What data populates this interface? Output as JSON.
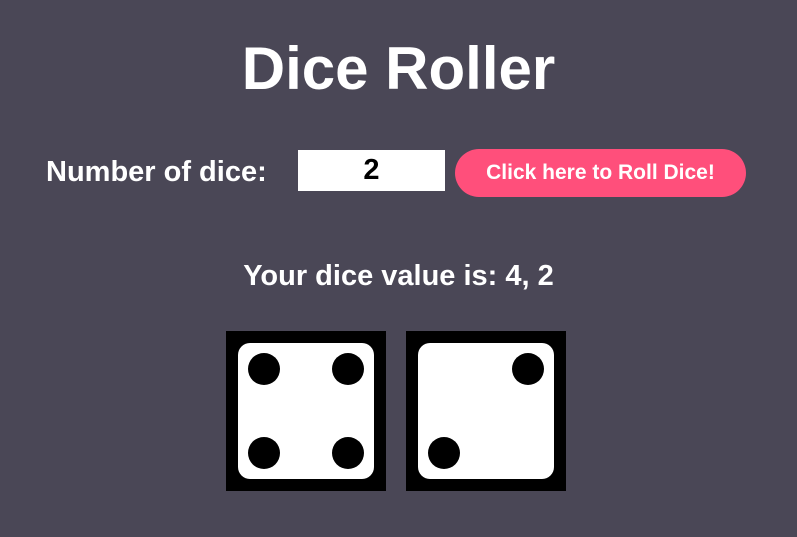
{
  "app": {
    "title": "Dice Roller"
  },
  "controls": {
    "number_label": "Number of dice:",
    "number_value": "2",
    "roll_button_label": "Click here to Roll Dice!"
  },
  "result": {
    "text": "Your dice value is: 4, 2"
  },
  "dice": [
    {
      "value": 4,
      "icon": "die-face-4-icon"
    },
    {
      "value": 2,
      "icon": "die-face-2-icon"
    }
  ],
  "colors": {
    "background": "#4a4756",
    "button": "#ff4f7b",
    "die_face": "#ffffff",
    "die_frame": "#000000",
    "pip": "#000000"
  }
}
